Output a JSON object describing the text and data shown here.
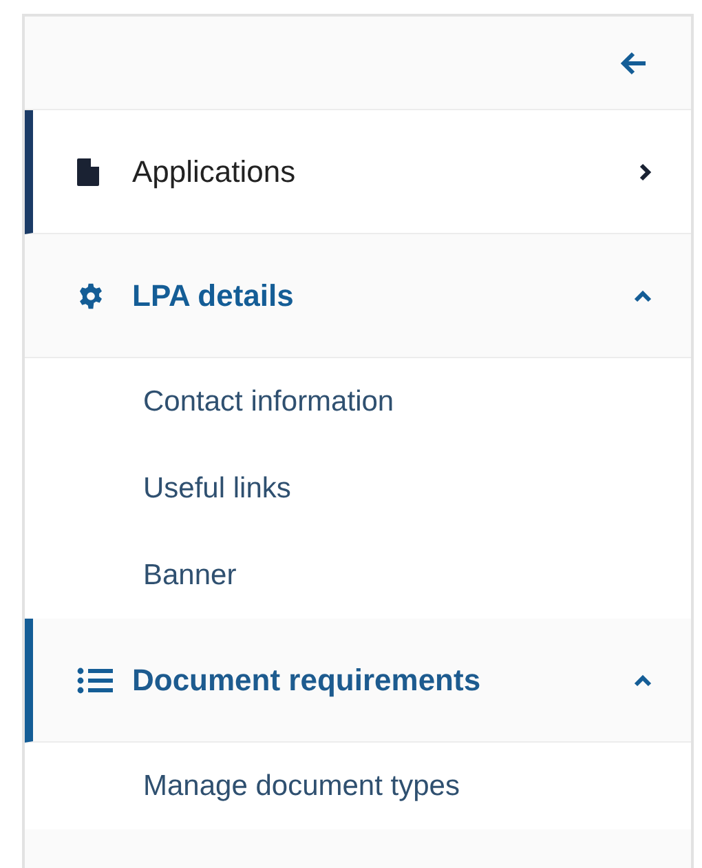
{
  "nav": [
    {
      "label": "Applications",
      "kind": "document",
      "selected": true,
      "expanded": false
    },
    {
      "label": "LPA details",
      "kind": "settings",
      "selected": false,
      "expanded": true,
      "children": [
        {
          "label": "Contact information"
        },
        {
          "label": "Useful links"
        },
        {
          "label": "Banner"
        }
      ]
    },
    {
      "label": "Document requirements",
      "kind": "list",
      "selected": true,
      "expanded": true,
      "children": [
        {
          "label": "Manage document types"
        }
      ]
    }
  ]
}
